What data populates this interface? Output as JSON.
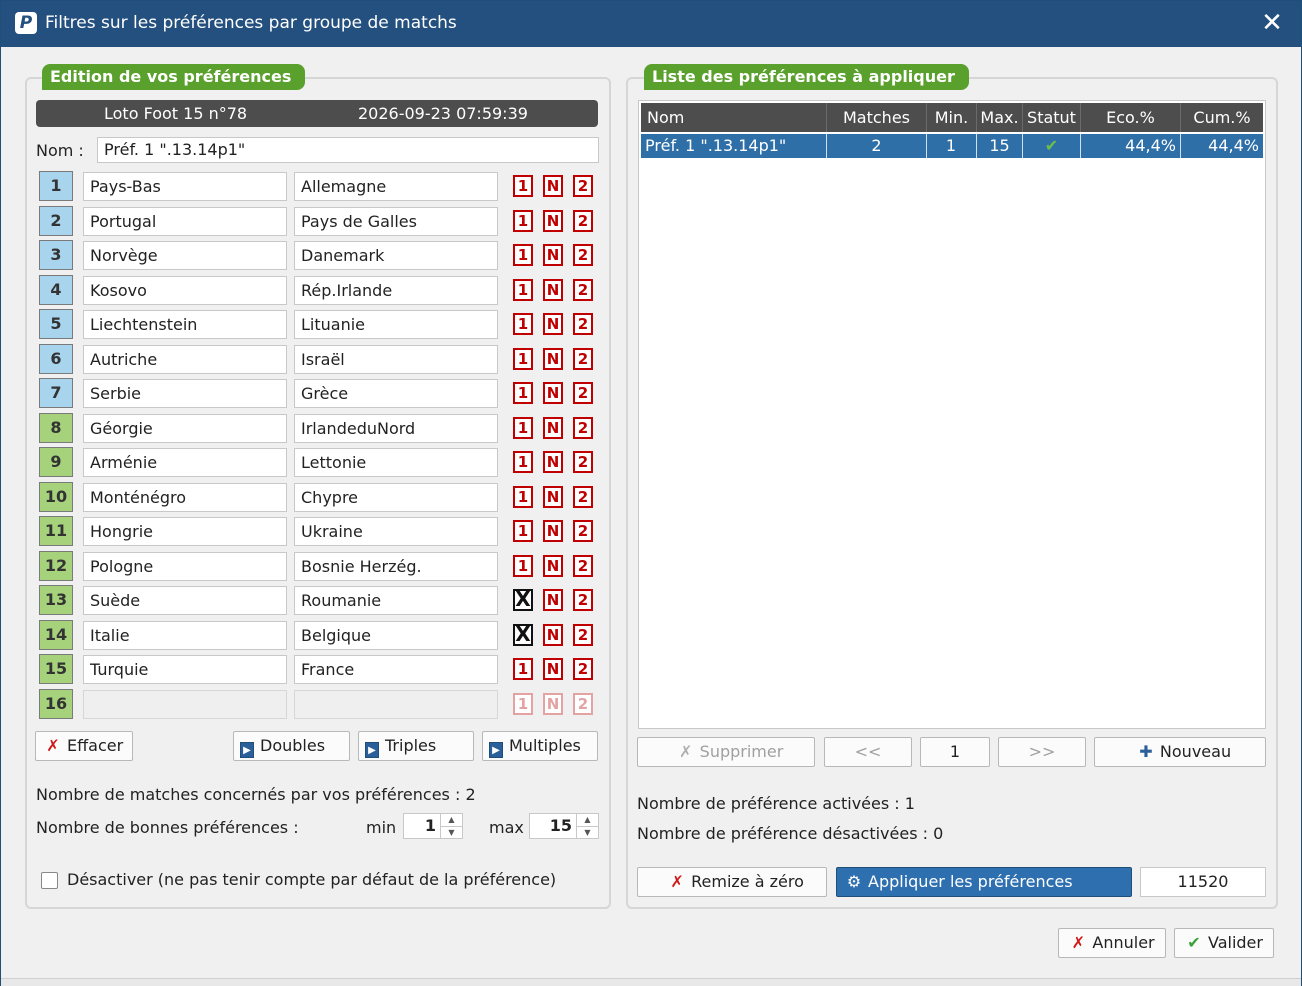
{
  "window": {
    "title": "Filtres sur les préférences par groupe de matchs",
    "logo_letter": "P",
    "close_glyph": "✕"
  },
  "left": {
    "heading": "Edition de vos préférences",
    "loto_label": "Loto Foot 15 n°78",
    "datetime": "2026-09-23 07:59:39",
    "name_label": "Nom :",
    "name_value": "Préf. 1 \".13.14p1\"",
    "matches": [
      {
        "num": "1",
        "home": "Pays-Bas",
        "away": "Allemagne",
        "o1": "1",
        "oN": "N",
        "o2": "2",
        "color": "blue",
        "state": "normal"
      },
      {
        "num": "2",
        "home": "Portugal",
        "away": "Pays de Galles",
        "o1": "1",
        "oN": "N",
        "o2": "2",
        "color": "blue",
        "state": "normal"
      },
      {
        "num": "3",
        "home": "Norvège",
        "away": "Danemark",
        "o1": "1",
        "oN": "N",
        "o2": "2",
        "color": "blue",
        "state": "normal"
      },
      {
        "num": "4",
        "home": "Kosovo",
        "away": "Rép.Irlande",
        "o1": "1",
        "oN": "N",
        "o2": "2",
        "color": "blue",
        "state": "normal"
      },
      {
        "num": "5",
        "home": "Liechtenstein",
        "away": "Lituanie",
        "o1": "1",
        "oN": "N",
        "o2": "2",
        "color": "blue",
        "state": "normal"
      },
      {
        "num": "6",
        "home": "Autriche",
        "away": "Israël",
        "o1": "1",
        "oN": "N",
        "o2": "2",
        "color": "blue",
        "state": "normal"
      },
      {
        "num": "7",
        "home": "Serbie",
        "away": "Grèce",
        "o1": "1",
        "oN": "N",
        "o2": "2",
        "color": "blue",
        "state": "normal"
      },
      {
        "num": "8",
        "home": "Géorgie",
        "away": "IrlandeduNord",
        "o1": "1",
        "oN": "N",
        "o2": "2",
        "color": "green",
        "state": "normal"
      },
      {
        "num": "9",
        "home": "Arménie",
        "away": "Lettonie",
        "o1": "1",
        "oN": "N",
        "o2": "2",
        "color": "green",
        "state": "normal"
      },
      {
        "num": "10",
        "home": "Monténégro",
        "away": "Chypre",
        "o1": "1",
        "oN": "N",
        "o2": "2",
        "color": "green",
        "state": "normal"
      },
      {
        "num": "11",
        "home": "Hongrie",
        "away": "Ukraine",
        "o1": "1",
        "oN": "N",
        "o2": "2",
        "color": "green",
        "state": "normal"
      },
      {
        "num": "12",
        "home": "Pologne",
        "away": "Bosnie Herzég.",
        "o1": "1",
        "oN": "N",
        "o2": "2",
        "color": "green",
        "state": "normal"
      },
      {
        "num": "13",
        "home": "Suède",
        "away": "Roumanie",
        "o1": "X",
        "oN": "N",
        "o2": "2",
        "color": "green",
        "state": "crossed"
      },
      {
        "num": "14",
        "home": "Italie",
        "away": "Belgique",
        "o1": "X",
        "oN": "N",
        "o2": "2",
        "color": "green",
        "state": "crossed"
      },
      {
        "num": "15",
        "home": "Turquie",
        "away": "France",
        "o1": "1",
        "oN": "N",
        "o2": "2",
        "color": "green",
        "state": "normal"
      },
      {
        "num": "16",
        "home": "",
        "away": "",
        "o1": "1",
        "oN": "N",
        "o2": "2",
        "color": "green",
        "state": "disabled"
      }
    ],
    "buttons": {
      "effacer": "Effacer",
      "doubles": "Doubles",
      "triples": "Triples",
      "multiples": "Multiples"
    },
    "matches_count_text": "Nombre de matches concernés par vos préférences : 2",
    "good_prefs_label": "Nombre de bonnes préférences :",
    "min_label": "min",
    "min_value": "1",
    "max_label": "max",
    "max_value": "15",
    "deactivate_label": "Désactiver (ne pas tenir compte par défaut de la préférence)"
  },
  "right": {
    "heading": "Liste des préférences à appliquer",
    "columns": {
      "nom": "Nom",
      "matches": "Matches",
      "min": "Min.",
      "max": "Max.",
      "statut": "Statut",
      "eco": "Eco.%",
      "cum": "Cum.%"
    },
    "rows": [
      {
        "nom": "Préf. 1 \".13.14p1\"",
        "matches": "2",
        "min": "1",
        "max": "15",
        "statut": "✔",
        "eco": "44,4%",
        "cum": "44,4%"
      }
    ],
    "buttons": {
      "supprimer": "Supprimer",
      "prev": "<<",
      "page": "1",
      "next": ">>",
      "nouveau": "Nouveau",
      "remize": "Remize à zéro",
      "appliquer": "Appliquer les préférences"
    },
    "activated_text": "Nombre de préférence activées : 1",
    "deactivated_text": "Nombre de préférence désactivées : 0",
    "result_value": "11520"
  },
  "footer": {
    "annuler": "Annuler",
    "valider": "Valider"
  },
  "icons": {
    "cross": "✗",
    "check": "✔",
    "play": "▶",
    "plus": "✚",
    "gear": "⚙"
  },
  "colors": {
    "titlebar": "#24507f",
    "heading_green": "#5aa02c",
    "selected_row": "#2e6fa8",
    "badge_blue": "#a9d4ee",
    "badge_green": "#a6d27c",
    "option_red": "#c00000"
  }
}
